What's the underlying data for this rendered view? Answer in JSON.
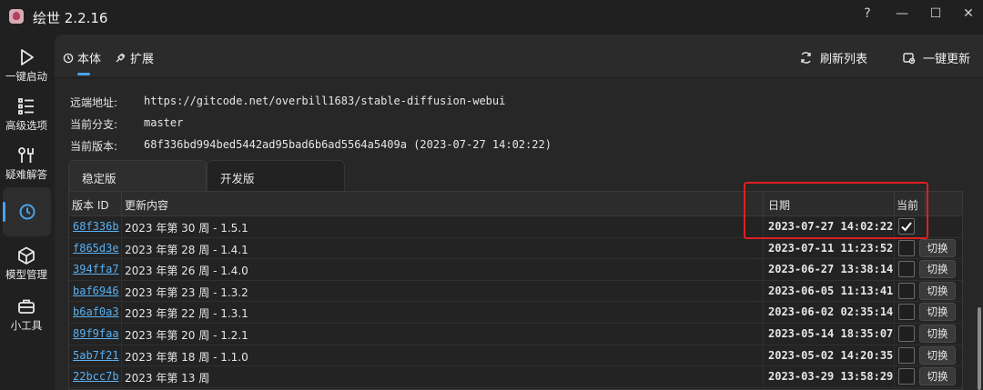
{
  "window": {
    "title": "绘世 2.2.16",
    "buttons": {
      "help": "?",
      "minimize": "—",
      "maximize": "☐",
      "close": "✕"
    }
  },
  "nav": {
    "items": [
      {
        "label": "一键启动",
        "icon": "play-icon"
      },
      {
        "label": "高级选项",
        "icon": "list-settings-icon"
      },
      {
        "label": "疑难解答",
        "icon": "tools-icon"
      },
      {
        "label": "",
        "icon": "history-icon",
        "active": true
      },
      {
        "label": "模型管理",
        "icon": "cube-icon"
      },
      {
        "label": "小工具",
        "icon": "toolbox-icon"
      }
    ]
  },
  "toolbar": {
    "tabs": [
      {
        "label": "本体",
        "icon": "history-icon"
      },
      {
        "label": "扩展",
        "icon": "puzzle-icon"
      }
    ],
    "refresh_label": "刷新列表",
    "update_label": "一键更新"
  },
  "info": {
    "remote_label": "远端地址:",
    "remote_value": "https://gitcode.net/overbill1683/stable-diffusion-webui",
    "branch_label": "当前分支:",
    "branch_value": "master",
    "version_label": "当前版本:",
    "version_value": "68f336bd994bed5442ad95bad6b6ad5564a5409a (2023-07-27 14:02:22)"
  },
  "subtabs": {
    "stable": "稳定版",
    "dev": "开发版"
  },
  "table": {
    "headers": {
      "id": "版本 ID",
      "desc": "更新内容",
      "date": "日期",
      "current": "当前"
    },
    "switch_label": "切换",
    "rows": [
      {
        "id": "68f336b",
        "desc": "2023 年第 30 周 - 1.5.1",
        "date": "2023-07-27 14:02:22",
        "current": true
      },
      {
        "id": "f865d3e",
        "desc": "2023 年第 28 周 - 1.4.1",
        "date": "2023-07-11 11:23:52",
        "current": false
      },
      {
        "id": "394ffa7",
        "desc": "2023 年第 26 周 - 1.4.0",
        "date": "2023-06-27 13:38:14",
        "current": false
      },
      {
        "id": "baf6946",
        "desc": "2023 年第 23 周 - 1.3.2",
        "date": "2023-06-05 11:13:41",
        "current": false
      },
      {
        "id": "b6af0a3",
        "desc": "2023 年第 22 周 - 1.3.1",
        "date": "2023-06-02 02:35:14",
        "current": false
      },
      {
        "id": "89f9faa",
        "desc": "2023 年第 20 周 - 1.2.1",
        "date": "2023-05-14 18:35:07",
        "current": false
      },
      {
        "id": "5ab7f21",
        "desc": "2023 年第 18 周 - 1.1.0",
        "date": "2023-05-02 14:20:35",
        "current": false
      },
      {
        "id": "22bcc7b",
        "desc": "2023 年第 13 周",
        "date": "2023-03-29 13:58:29",
        "current": false
      }
    ]
  },
  "colors": {
    "accent": "#4aa3e8",
    "highlight": "#e02020",
    "link": "#5ab0f0"
  }
}
